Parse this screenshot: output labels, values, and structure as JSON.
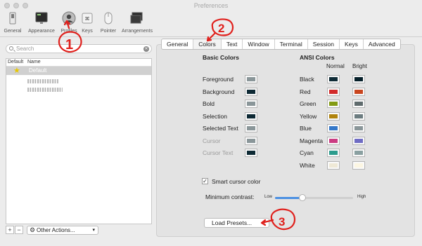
{
  "window": {
    "title": "Preferences"
  },
  "toolbar": {
    "items": [
      {
        "label": "General",
        "icon": "switch-icon"
      },
      {
        "label": "Appearance",
        "icon": "monitor-icon"
      },
      {
        "label": "Profiles",
        "icon": "person-icon",
        "selected": true
      },
      {
        "label": "Keys",
        "icon": "keyboard-icon"
      },
      {
        "label": "Pointer",
        "icon": "pointer-icon"
      },
      {
        "label": "Arrangements",
        "icon": "windows-icon"
      }
    ]
  },
  "search": {
    "placeholder": "Search"
  },
  "profiles": {
    "header": {
      "default": "Default",
      "name": "Name"
    },
    "rows": [
      {
        "name": "Default",
        "is_default": true,
        "selected": true
      }
    ]
  },
  "bottom_bar": {
    "add": "+",
    "remove": "−",
    "other_actions": "Other Actions..."
  },
  "tabs": [
    {
      "label": "General"
    },
    {
      "label": "Colors",
      "active": true
    },
    {
      "label": "Text"
    },
    {
      "label": "Window"
    },
    {
      "label": "Terminal"
    },
    {
      "label": "Session"
    },
    {
      "label": "Keys"
    },
    {
      "label": "Advanced"
    }
  ],
  "basic_colors": {
    "title": "Basic Colors",
    "items": [
      {
        "label": "Foreground",
        "color": "#8a9699"
      },
      {
        "label": "Background",
        "color": "#0e2a35"
      },
      {
        "label": "Bold",
        "color": "#8a9699"
      },
      {
        "label": "Selection",
        "color": "#0e2a35"
      },
      {
        "label": "Selected Text",
        "color": "#8a9699"
      },
      {
        "label": "Cursor",
        "color": "#8a9699",
        "dim": true
      },
      {
        "label": "Cursor Text",
        "color": "#0e2a35",
        "dim": true
      }
    ]
  },
  "ansi_colors": {
    "title": "ANSI Colors",
    "normal_label": "Normal",
    "bright_label": "Bright",
    "items": [
      {
        "label": "Black",
        "normal": "#0e2a35",
        "bright": "#06202a"
      },
      {
        "label": "Red",
        "normal": "#d22a2a",
        "bright": "#c9451e"
      },
      {
        "label": "Green",
        "normal": "#839b13",
        "bright": "#5f6b6d"
      },
      {
        "label": "Yellow",
        "normal": "#b0830c",
        "bright": "#6c7c80"
      },
      {
        "label": "Blue",
        "normal": "#3478c9",
        "bright": "#8a9699"
      },
      {
        "label": "Magenta",
        "normal": "#cb3b82",
        "bright": "#6f6cc4"
      },
      {
        "label": "Cyan",
        "normal": "#2c9c8d",
        "bright": "#8aa0a1"
      },
      {
        "label": "White",
        "normal": "#efe9d6",
        "bright": "#fcf6e2"
      }
    ]
  },
  "smart_cursor": {
    "label": "Smart cursor color",
    "checked": true
  },
  "min_contrast": {
    "label": "Minimum contrast:",
    "low": "Low",
    "high": "High",
    "value": 0.35
  },
  "load_presets": {
    "label": "Load Presets..."
  },
  "annotations": [
    "1",
    "2",
    "3"
  ],
  "colors": {
    "accent": "#4a90e2",
    "annotation": "#e0201c",
    "selection_row": "#d0d0d0"
  }
}
